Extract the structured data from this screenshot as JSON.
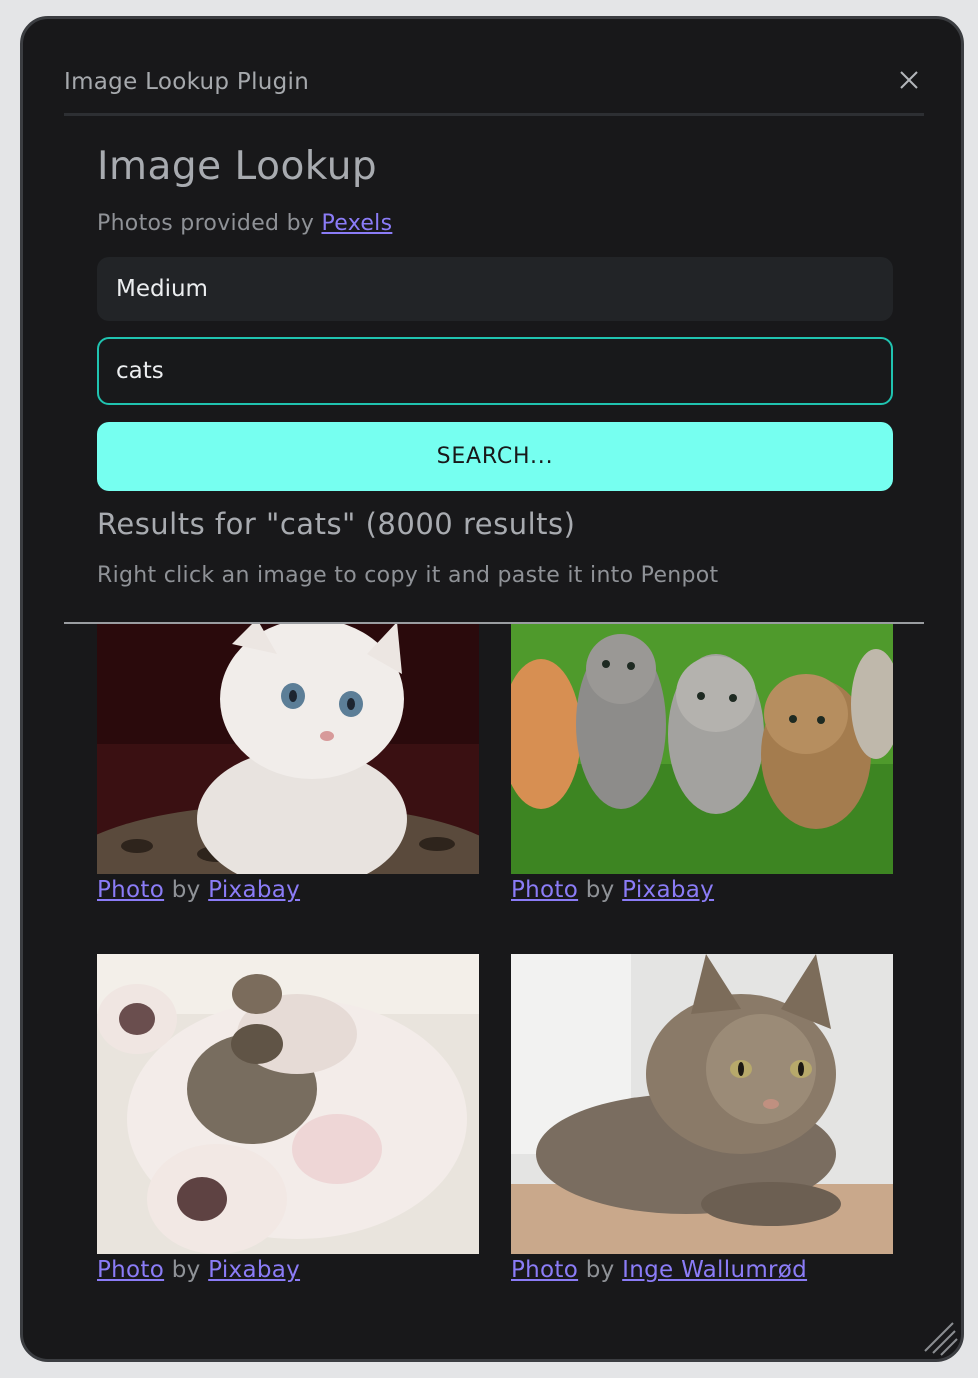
{
  "modal": {
    "title": "Image Lookup Plugin"
  },
  "page": {
    "heading": "Image Lookup",
    "provided_prefix": "Photos provided by",
    "provider_link": "Pexels"
  },
  "size_select": {
    "value": "Medium"
  },
  "search": {
    "value": "cats",
    "button_label": "SEARCH..."
  },
  "results": {
    "heading": "Results for \"cats\" (8000 results)",
    "hint": "Right click an image to copy it and paste it into Penpot",
    "items": [
      {
        "photo_label": "Photo",
        "by": "by",
        "author": "Pixabay",
        "subject": "white kitten"
      },
      {
        "photo_label": "Photo",
        "by": "by",
        "author": "Pixabay",
        "subject": "kittens on grass"
      },
      {
        "photo_label": "Photo",
        "by": "by",
        "author": "Pixabay",
        "subject": "sleeping kitten"
      },
      {
        "photo_label": "Photo",
        "by": "by",
        "author": "Inge Wallumrød",
        "subject": "tabby cat lying"
      }
    ]
  },
  "colors": {
    "background": "#18181a",
    "accent": "#76fff0",
    "input_border": "#20c3b0",
    "link": "#8b7cf7"
  },
  "icons": {
    "close": "close-icon",
    "resize": "resize-grip-icon"
  }
}
